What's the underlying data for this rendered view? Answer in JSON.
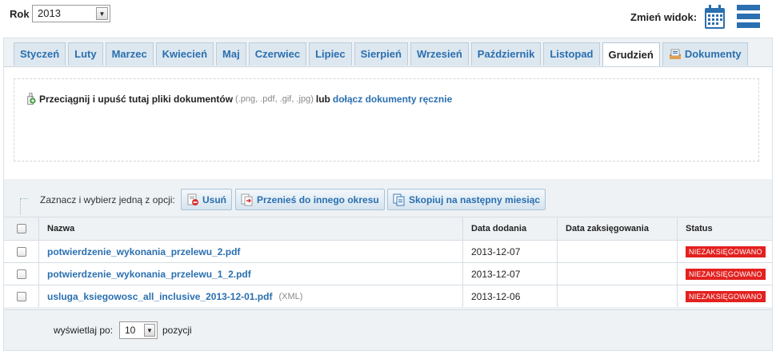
{
  "year": {
    "label": "Rok",
    "selected": "2013"
  },
  "view": {
    "label": "Zmień widok:",
    "icons": [
      "calendar-icon",
      "list-view-icon"
    ],
    "accent": "#2a6fb0"
  },
  "tabs": [
    {
      "label": "Styczeń"
    },
    {
      "label": "Luty"
    },
    {
      "label": "Marzec"
    },
    {
      "label": "Kwiecień"
    },
    {
      "label": "Maj"
    },
    {
      "label": "Czerwiec"
    },
    {
      "label": "Lipiec"
    },
    {
      "label": "Sierpień"
    },
    {
      "label": "Wrzesień"
    },
    {
      "label": "Październik"
    },
    {
      "label": "Listopad"
    },
    {
      "label": "Grudzień",
      "active": true
    },
    {
      "label": "Dokumenty",
      "icon": "documents-icon"
    }
  ],
  "dropzone": {
    "text": "Przeciągnij i upuść tutaj pliki dokumentów",
    "extensions": "(.png, .pdf, .gif, .jpg)",
    "or": "lub",
    "link": "dołącz dokumenty ręcznie"
  },
  "actions": {
    "label": "Zaznacz i wybierz jedną z opcji:",
    "delete": "Usuń",
    "move": "Przenieś do innego okresu",
    "copy": "Skopiuj na następny miesiąc"
  },
  "table": {
    "headers": {
      "name": "Nazwa",
      "added": "Data dodania",
      "booked": "Data zaksięgowania",
      "status": "Status"
    },
    "rows": [
      {
        "name": "potwierdzenie_wykonania_przelewu_2.pdf",
        "suffix": "",
        "added": "2013-12-07",
        "booked": "",
        "status": "NIEZAKSIĘGOWANO"
      },
      {
        "name": "potwierdzenie_wykonania_przelewu_1_2.pdf",
        "suffix": "",
        "added": "2013-12-07",
        "booked": "",
        "status": "NIEZAKSIĘGOWANO"
      },
      {
        "name": "usluga_ksiegowosc_all_inclusive_2013-12-01.pdf",
        "suffix": "(XML)",
        "added": "2013-12-06",
        "booked": "",
        "status": "NIEZAKSIĘGOWANO"
      }
    ],
    "status_color": "#e3211f"
  },
  "pagination": {
    "label": "wyświetlaj po:",
    "selected": "10",
    "suffix": "pozycji"
  }
}
